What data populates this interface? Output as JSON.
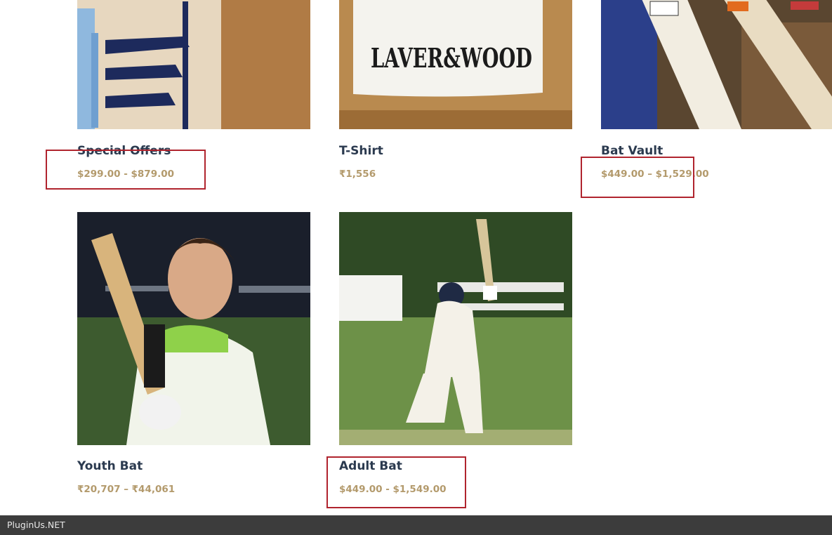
{
  "products": [
    {
      "title": "Special Offers",
      "price_from": "$299.00",
      "price_sep": " - ",
      "price_to": "$879.00",
      "image": "cricket-bat-label-image"
    },
    {
      "title": "T-Shirt",
      "price": "₹1,556",
      "image": "tshirt-image",
      "image_text": "LAVER&WOOD"
    },
    {
      "title": "Bat Vault",
      "price_from": "$449.00",
      "price_sep": " – ",
      "price_to": "$1,529.00",
      "image": "bat-vault-image"
    },
    {
      "title": "Youth Bat",
      "price_from": "₹20,707",
      "price_sep": " – ",
      "price_to": "₹44,061",
      "image": "youth-player-image"
    },
    {
      "title": "Adult Bat",
      "price_from": "$449.00",
      "price_sep": " - ",
      "price_to": "$1,549.00",
      "image": "adult-batsman-image"
    }
  ],
  "footer": {
    "brand": "PluginUs.NET"
  },
  "colors": {
    "title": "#2b3a4f",
    "price": "#b39a6c",
    "highlight": "#b0242e",
    "footer_bg": "#3c3c3c"
  }
}
